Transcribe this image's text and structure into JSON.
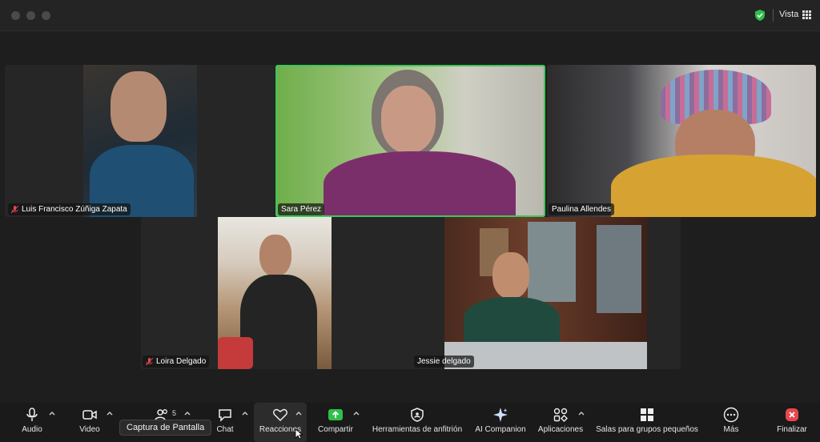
{
  "header": {
    "view_label": "Vista",
    "icons": [
      "shield-icon",
      "grid-icon"
    ]
  },
  "participants": [
    {
      "name": "Luis Francisco Zúñiga Zapata",
      "muted": true
    },
    {
      "name": "Sara Pérez",
      "muted": false,
      "active_speaker": true
    },
    {
      "name": "Paulina Allendes",
      "muted": false
    },
    {
      "name": "Loira Delgado",
      "muted": true
    },
    {
      "name": "Jessie delgado",
      "muted": false
    }
  ],
  "toolbar": {
    "audio": "Audio",
    "video": "Video",
    "participants_count": "5",
    "chat": "Chat",
    "reactions": "Reacciones",
    "share": "Compartir",
    "host_tools": "Herramientas de anfitrión",
    "ai_companion": "AI Companion",
    "apps": "Aplicaciones",
    "breakout_rooms": "Salas para grupos pequeños",
    "more": "Más",
    "end": "Finalizar"
  },
  "tooltip": "Captura de Pantalla",
  "colors": {
    "active_speaker_border": "#3ec75a",
    "share_green": "#2fbf4b",
    "end_red": "#e5484d"
  }
}
